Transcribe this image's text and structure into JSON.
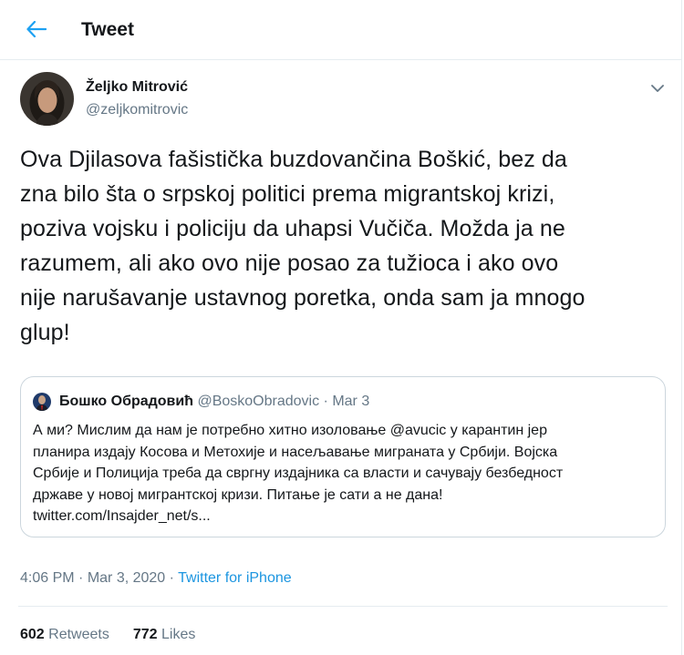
{
  "header": {
    "title": "Tweet",
    "back_icon": "back-arrow-icon"
  },
  "tweet": {
    "author_name": "Željko Mitrović",
    "author_handle": "@zeljkomitrovic",
    "caret_icon": "chevron-down-icon",
    "text": "Ova Djilasova fašistička buzdovančina Boškić, bez da\nzna bilo šta o srpskoj politici prema migrantskoj krizi,\npoziva vojsku i policiju da uhapsi Vučiča. Možda ja ne\nrazumem, ali ako ovo nije posao za tužioca i ako ovo\nnije narušavanje ustavnog poretka, onda sam ja mnogo\nglup!",
    "time": "4:06 PM",
    "date": "Mar 3, 2020",
    "source": "Twitter for iPhone",
    "separator": " · "
  },
  "quote": {
    "name": "Бошко Обрадовић",
    "handle": "@BoskoObradovic",
    "date": "Mar 3",
    "separator": " · ",
    "text": "А ми? Мислим да нам је потребно хитно изоловање @avucic у карантин јер\nпланира издају Косова и Метохије и насељавање миграната у Србији. Војска\nСрбије и Полиција треба да свргну издајника са власти и сачувају безбедност\nдржаве у новој мигрантској кризи. Питање је сати а не дана!\ntwitter.com/Insajder_net/s..."
  },
  "stats": {
    "retweets_count": "602",
    "retweets_label": "Retweets",
    "likes_count": "772",
    "likes_label": "Likes"
  },
  "colors": {
    "accent": "#1b95e0",
    "text_primary": "#14171a",
    "text_secondary": "#657786",
    "border": "#e6ecf0"
  }
}
